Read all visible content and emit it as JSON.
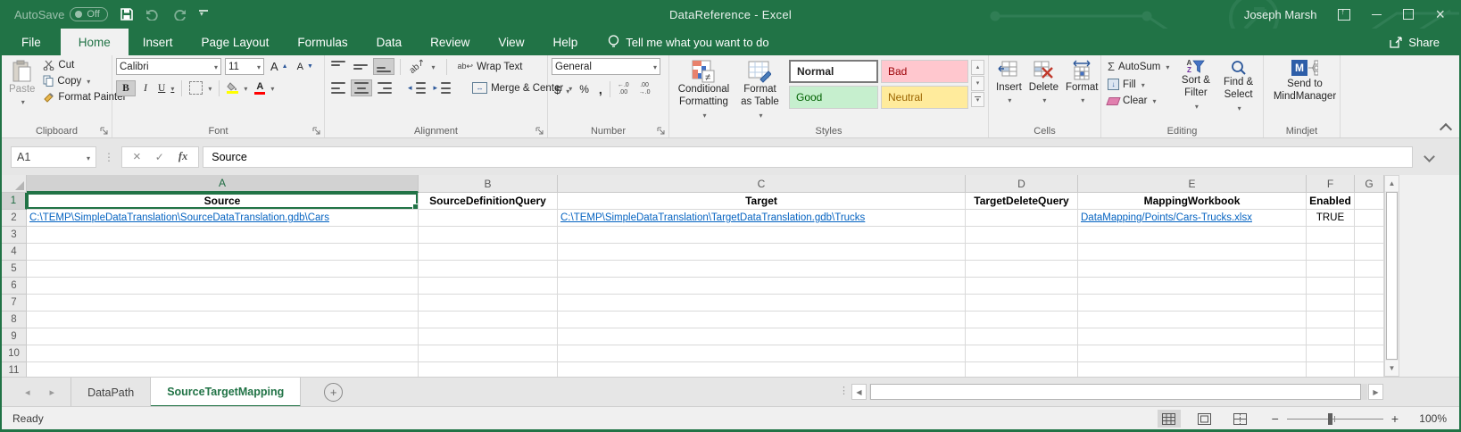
{
  "titlebar": {
    "autosave_label": "AutoSave",
    "autosave_state": "Off",
    "title": "DataReference  -  Excel",
    "user": "Joseph Marsh"
  },
  "tabs": {
    "items": [
      {
        "label": "File"
      },
      {
        "label": "Home"
      },
      {
        "label": "Insert"
      },
      {
        "label": "Page Layout"
      },
      {
        "label": "Formulas"
      },
      {
        "label": "Data"
      },
      {
        "label": "Review"
      },
      {
        "label": "View"
      },
      {
        "label": "Help"
      }
    ],
    "tell_me": "Tell me what you want to do",
    "share": "Share"
  },
  "ribbon": {
    "clipboard": {
      "label": "Clipboard",
      "paste": "Paste",
      "cut": "Cut",
      "copy": "Copy",
      "format_painter": "Format Painter"
    },
    "font": {
      "label": "Font",
      "name": "Calibri",
      "size": "11"
    },
    "alignment": {
      "label": "Alignment",
      "wrap": "Wrap Text",
      "merge": "Merge & Center"
    },
    "number": {
      "label": "Number",
      "format": "General"
    },
    "styles": {
      "label": "Styles",
      "conditional": "Conditional Formatting",
      "format_table": "Format as Table",
      "normal": "Normal",
      "bad": "Bad",
      "good": "Good",
      "neutral": "Neutral"
    },
    "cells": {
      "label": "Cells",
      "insert": "Insert",
      "delete": "Delete",
      "format": "Format"
    },
    "editing": {
      "label": "Editing",
      "autosum": "AutoSum",
      "fill": "Fill",
      "clear": "Clear",
      "sort_filter": "Sort & Filter",
      "find_select": "Find & Select"
    },
    "mindjet": {
      "label": "Mindjet",
      "send": "Send to MindManager"
    }
  },
  "glyphs": {
    "bold": "B",
    "italic": "I",
    "underline": "U",
    "font_color_letter": "A",
    "grow_letter": "A",
    "shrink_letter": "A",
    "currency": "$",
    "percent": "%",
    "comma": ",",
    "sigma": "Σ",
    "inc_decimal": "←.0\n.00",
    "dec_decimal": ".00\n→.0",
    "fx": "fx",
    "cancel": "×",
    "enter": "✓",
    "wrap_ab": "ab",
    "orient_ab": "ab",
    "sort_a": "A",
    "sort_z": "Z",
    "not_equal": "≠",
    "mindmanager_m": "M",
    "plus": "+",
    "minus": "−"
  },
  "formula_bar": {
    "name_box": "A1",
    "value": "Source"
  },
  "sheet": {
    "col_letters": [
      "A",
      "B",
      "C",
      "D",
      "E",
      "F",
      "G"
    ],
    "row_numbers": [
      "1",
      "2",
      "3",
      "4",
      "5",
      "6",
      "7",
      "8",
      "9",
      "10",
      "11"
    ],
    "headers": {
      "a": "Source",
      "b": "SourceDefinitionQuery",
      "c": "Target",
      "d": "TargetDeleteQuery",
      "e": "MappingWorkbook",
      "f": "Enabled"
    },
    "row2": {
      "a": "C:\\TEMP\\SimpleDataTranslation\\SourceDataTranslation.gdb\\Cars",
      "c": "C:\\TEMP\\SimpleDataTranslation\\TargetDataTranslation.gdb\\Trucks",
      "e": "DataMapping/Points/Cars-Trucks.xlsx",
      "f": "TRUE"
    }
  },
  "sheet_tabs": {
    "tab1": "DataPath",
    "tab2": "SourceTargetMapping"
  },
  "status": {
    "ready": "Ready",
    "zoom": "100%"
  },
  "colors": {
    "accent": "#217346",
    "hyperlink": "#0563C1",
    "bad_bg": "#FFC7CE",
    "bad_text": "#9C0006",
    "good_bg": "#C6EFCE",
    "good_text": "#006100",
    "neutral_bg": "#FFEB9C",
    "neutral_text": "#9C6500"
  }
}
